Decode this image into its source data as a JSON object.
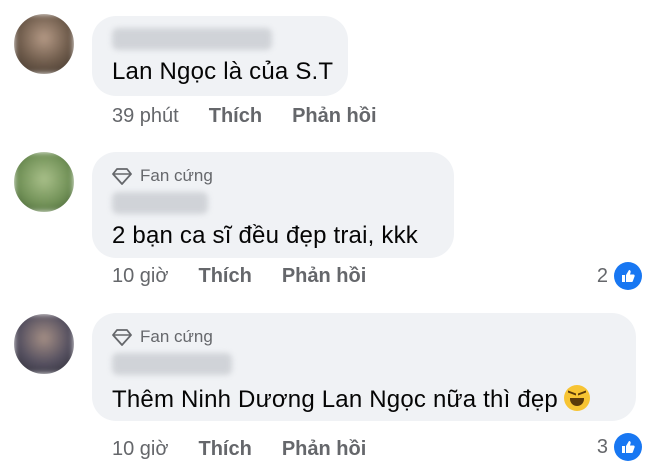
{
  "comments": [
    {
      "badge": "",
      "text": "Lan Ngọc là của S.T",
      "time": "39 phút",
      "like": "Thích",
      "reply": "Phản hồi",
      "reaction_count": "",
      "avatar_color": "#8a7a6a"
    },
    {
      "badge": "Fan cứng",
      "text": "2 bạn ca sĩ đều đẹp trai, kkk",
      "time": "10 giờ",
      "like": "Thích",
      "reply": "Phản hồi",
      "reaction_count": "2",
      "avatar_color": "#7fa06a"
    },
    {
      "badge": "Fan cứng",
      "text": "Thêm Ninh Dương Lan Ngọc nữa thì đẹp",
      "time": "10 giờ",
      "like": "Thích",
      "reply": "Phản hồi",
      "reaction_count": "3",
      "avatar_color": "#5a5560"
    }
  ],
  "icons": {
    "badge": "diamond-icon",
    "reaction": "thumbs-up-icon",
    "emoji": "grinning-squinting-face-emoji"
  },
  "colors": {
    "bubble": "#f0f2f5",
    "meta_text": "#65676b",
    "like_blue": "#1877f2"
  }
}
